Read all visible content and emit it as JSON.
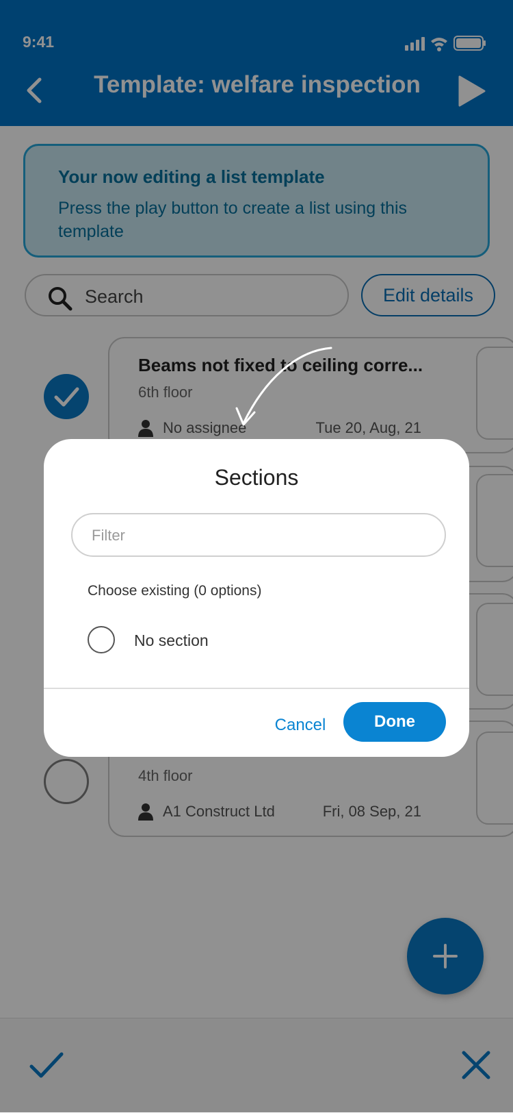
{
  "status_bar": {
    "time": "9:41"
  },
  "header": {
    "title": "Template: welfare inspection"
  },
  "banner": {
    "title": "Your now editing a list template",
    "text": "Press the play button to create a list using this template"
  },
  "search": {
    "placeholder": "Search"
  },
  "edit_details_label": "Edit details",
  "tasks": [
    {
      "title": "Beams not fixed to ceiling corre...",
      "floor": "6th floor",
      "assignee": "No assignee",
      "date": "Tue 20, Aug, 21",
      "checked": true
    },
    {
      "title": "",
      "floor": "4th floor",
      "assignee": "A1 Construct Ltd",
      "date": "Fri, 08 Sep, 21",
      "checked": false
    }
  ],
  "modal": {
    "title": "Sections",
    "filter_placeholder": "Filter",
    "choose_label": "Choose existing (0 options)",
    "option_label": "No section",
    "cancel_label": "Cancel",
    "done_label": "Done"
  },
  "colors": {
    "brand_blue": "#0073c5",
    "button_blue": "#0a84d2",
    "banner_border": "#25a6d8",
    "banner_text": "#066f9c"
  },
  "icons": [
    "back-chevron-icon",
    "play-icon",
    "search-icon",
    "person-icon",
    "checkmark-icon",
    "plus-icon",
    "close-icon",
    "signal-icon",
    "wifi-icon",
    "battery-icon"
  ]
}
